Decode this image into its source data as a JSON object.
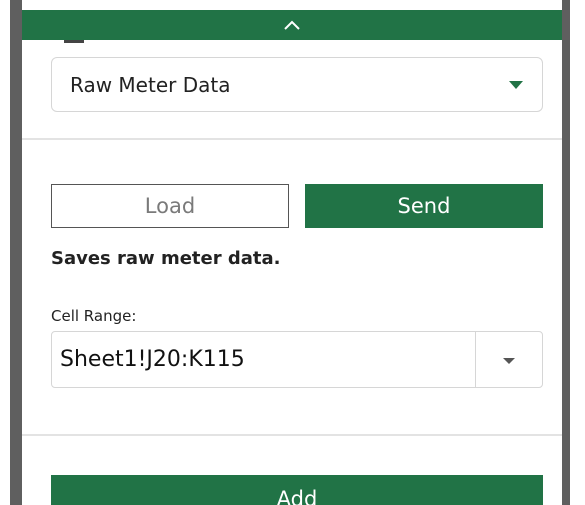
{
  "header": {
    "collapse_icon": "chevron-up-icon"
  },
  "mode_select": {
    "value": "Raw Meter Data",
    "icon": "caret-down-icon"
  },
  "actions": {
    "load_label": "Load",
    "send_label": "Send"
  },
  "description": "Saves raw meter data.",
  "cell_range": {
    "label": "Cell Range:",
    "value": "Sheet1!J20:K115",
    "icon": "caret-down-icon"
  },
  "add_button": {
    "label": "Add"
  },
  "colors": {
    "accent": "#217346",
    "frame": "#5f5f5f",
    "border": "#d6d6d6",
    "divider": "#e3e3e3"
  }
}
